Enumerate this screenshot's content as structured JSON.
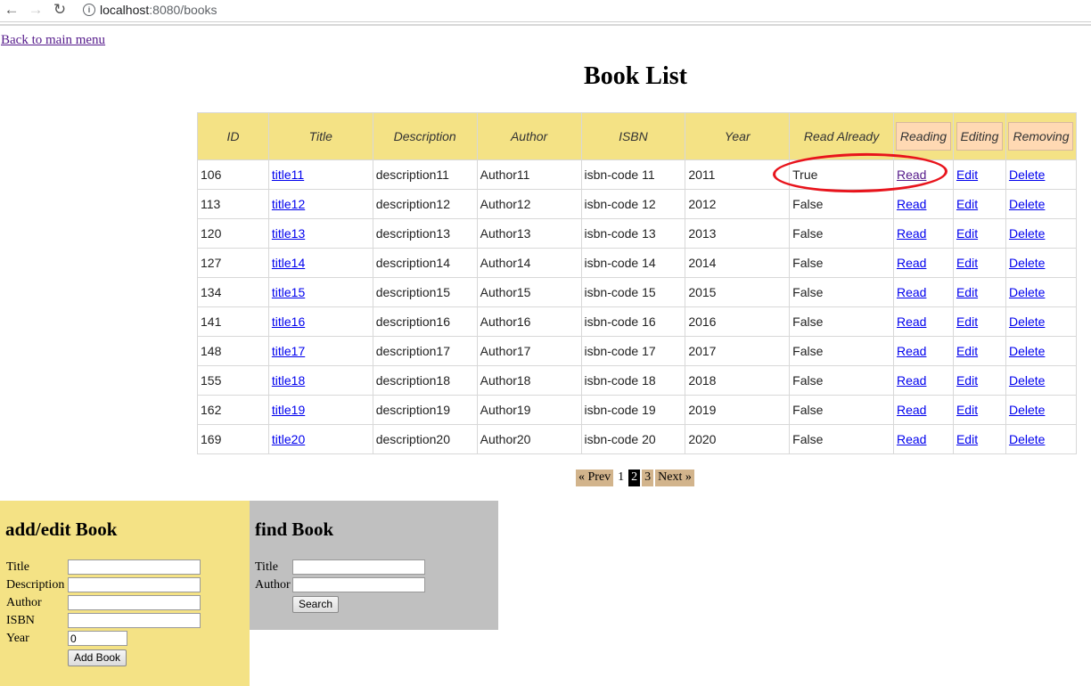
{
  "browser": {
    "url_host": "localhost",
    "url_rest": ":8080/books"
  },
  "back_link": "Back to main menu",
  "title": "Book List",
  "table": {
    "headers": [
      "ID",
      "Title",
      "Description",
      "Author",
      "ISBN",
      "Year",
      "Read Already",
      "Reading",
      "Editing",
      "Removing"
    ],
    "rows": [
      {
        "id": "106",
        "title": "title11",
        "description": "description11",
        "author": "Author11",
        "isbn": "isbn-code 11",
        "year": "2011",
        "read_already": "True",
        "read": "Read",
        "edit": "Edit",
        "delete": "Delete"
      },
      {
        "id": "113",
        "title": "title12",
        "description": "description12",
        "author": "Author12",
        "isbn": "isbn-code 12",
        "year": "2012",
        "read_already": "False",
        "read": "Read",
        "edit": "Edit",
        "delete": "Delete"
      },
      {
        "id": "120",
        "title": "title13",
        "description": "description13",
        "author": "Author13",
        "isbn": "isbn-code 13",
        "year": "2013",
        "read_already": "False",
        "read": "Read",
        "edit": "Edit",
        "delete": "Delete"
      },
      {
        "id": "127",
        "title": "title14",
        "description": "description14",
        "author": "Author14",
        "isbn": "isbn-code 14",
        "year": "2014",
        "read_already": "False",
        "read": "Read",
        "edit": "Edit",
        "delete": "Delete"
      },
      {
        "id": "134",
        "title": "title15",
        "description": "description15",
        "author": "Author15",
        "isbn": "isbn-code 15",
        "year": "2015",
        "read_already": "False",
        "read": "Read",
        "edit": "Edit",
        "delete": "Delete"
      },
      {
        "id": "141",
        "title": "title16",
        "description": "description16",
        "author": "Author16",
        "isbn": "isbn-code 16",
        "year": "2016",
        "read_already": "False",
        "read": "Read",
        "edit": "Edit",
        "delete": "Delete"
      },
      {
        "id": "148",
        "title": "title17",
        "description": "description17",
        "author": "Author17",
        "isbn": "isbn-code 17",
        "year": "2017",
        "read_already": "False",
        "read": "Read",
        "edit": "Edit",
        "delete": "Delete"
      },
      {
        "id": "155",
        "title": "title18",
        "description": "description18",
        "author": "Author18",
        "isbn": "isbn-code 18",
        "year": "2018",
        "read_already": "False",
        "read": "Read",
        "edit": "Edit",
        "delete": "Delete"
      },
      {
        "id": "162",
        "title": "title19",
        "description": "description19",
        "author": "Author19",
        "isbn": "isbn-code 19",
        "year": "2019",
        "read_already": "False",
        "read": "Read",
        "edit": "Edit",
        "delete": "Delete"
      },
      {
        "id": "169",
        "title": "title20",
        "description": "description20",
        "author": "Author20",
        "isbn": "isbn-code 20",
        "year": "2020",
        "read_already": "False",
        "read": "Read",
        "edit": "Edit",
        "delete": "Delete"
      }
    ]
  },
  "pagination": {
    "prev": "« Prev",
    "pages": [
      "1",
      "2",
      "3"
    ],
    "current": "2",
    "next": "Next »"
  },
  "add_form": {
    "heading": "add/edit Book",
    "labels": {
      "title": "Title",
      "description": "Description",
      "author": "Author",
      "isbn": "ISBN",
      "year": "Year"
    },
    "values": {
      "title": "",
      "description": "",
      "author": "",
      "isbn": "",
      "year": "0"
    },
    "submit": "Add Book"
  },
  "find_form": {
    "heading": "find Book",
    "labels": {
      "title": "Title",
      "author": "Author"
    },
    "values": {
      "title": "",
      "author": ""
    },
    "submit": "Search"
  },
  "colors": {
    "header_bg": "#f4e285",
    "action_header_bg": "#ffd9b3",
    "highlight": "#e8141c",
    "find_panel_bg": "#c0c0c0",
    "pagination_bg": "#d2b48c"
  }
}
